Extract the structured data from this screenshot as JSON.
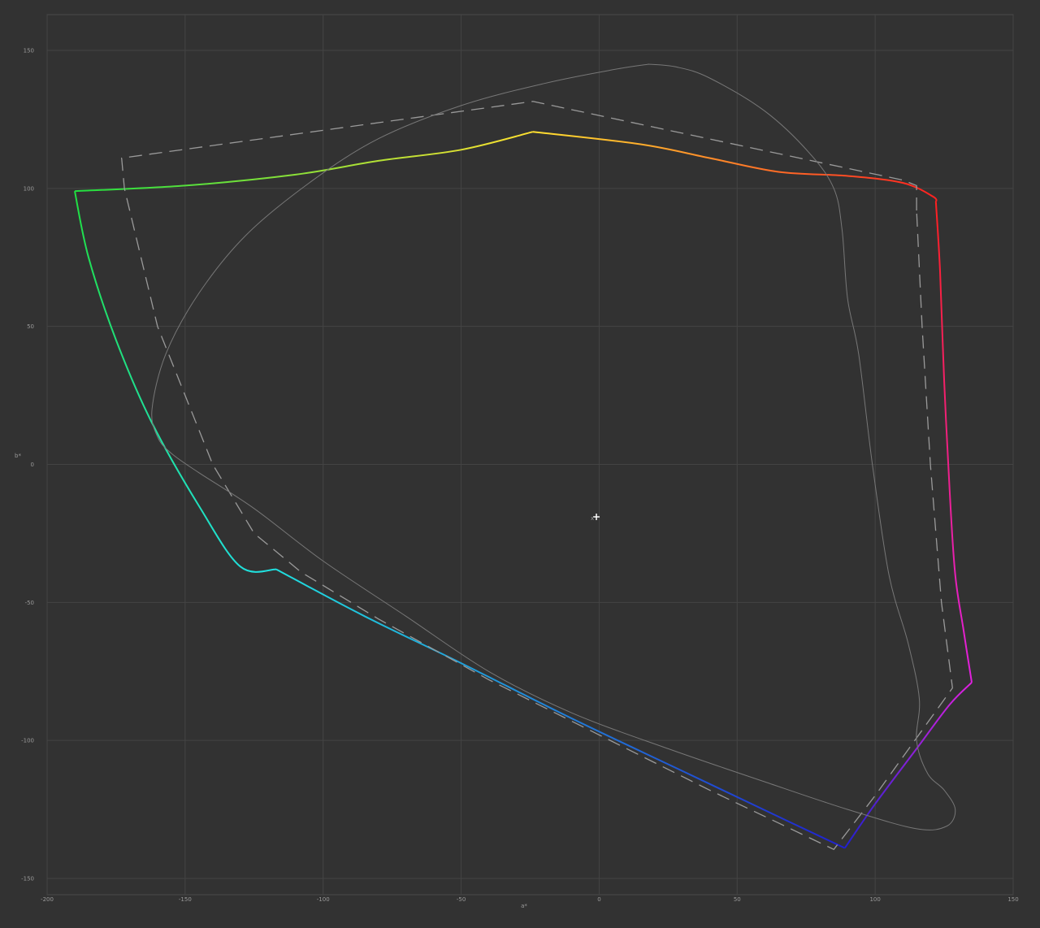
{
  "chart_data": {
    "type": "line",
    "title": "",
    "xlabel": "a*",
    "ylabel": "b*",
    "xlim": [
      -200,
      150
    ],
    "ylim": [
      -150,
      150
    ],
    "grid": true,
    "x_ticks": [
      -200,
      -150,
      -100,
      -50,
      0,
      50,
      100,
      150
    ],
    "y_ticks": [
      150,
      100,
      50,
      0,
      -50,
      -100,
      -150
    ],
    "x_tick_labels": [
      "-200",
      "-150",
      "-100",
      "-50",
      "0",
      "50",
      "100",
      "150"
    ],
    "y_tick_labels": [
      "150",
      "100",
      "50",
      "0",
      "-50",
      "-100",
      "-150"
    ],
    "white_point_marker": {
      "x": -1,
      "y": -19,
      "glyph": "+",
      "label": "x"
    },
    "series": [
      {
        "style": "solid-gradient",
        "segments": [
          {
            "from_color": "#ff2020",
            "to_color": "#ffe030",
            "points": [
              [
                122,
                95
              ],
              [
                121,
                97
              ],
              [
                110,
                102
              ],
              [
                90,
                104.5
              ],
              [
                65,
                106
              ],
              [
                40,
                111
              ],
              [
                15,
                116
              ],
              [
                -24,
                120.5
              ]
            ]
          },
          {
            "from_color": "#ffe030",
            "to_color": "#20e040",
            "points": [
              [
                -24,
                120.5
              ],
              [
                -50,
                114
              ],
              [
                -80,
                110
              ],
              [
                -110,
                105
              ],
              [
                -150,
                101
              ],
              [
                -190,
                99
              ]
            ]
          },
          {
            "from_color": "#20e040",
            "to_color": "#20e0e0",
            "points": [
              [
                -190,
                99
              ],
              [
                -185,
                75
              ],
              [
                -175,
                45
              ],
              [
                -162,
                15
              ],
              [
                -145,
                -15
              ],
              [
                -130,
                -37
              ],
              [
                -117,
                -38
              ]
            ]
          },
          {
            "from_color": "#20e0e0",
            "to_color": "#2020d0",
            "points": [
              [
                -117,
                -38
              ],
              [
                -85,
                -55
              ],
              [
                -50,
                -72
              ],
              [
                -10,
                -92
              ],
              [
                30,
                -111
              ],
              [
                70,
                -130
              ],
              [
                89,
                -139
              ]
            ]
          },
          {
            "from_color": "#2020d0",
            "to_color": "#e020e0",
            "points": [
              [
                89,
                -139
              ],
              [
                100,
                -123
              ],
              [
                115,
                -103
              ],
              [
                127,
                -87
              ],
              [
                135,
                -79
              ]
            ]
          },
          {
            "from_color": "#e020e0",
            "to_color": "#ff2020",
            "points": [
              [
                135,
                -79
              ],
              [
                132,
                -60
              ],
              [
                129,
                -40
              ],
              [
                127,
                -10
              ],
              [
                125,
                30
              ],
              [
                123.5,
                70
              ],
              [
                122,
                95
              ]
            ]
          }
        ]
      },
      {
        "style": "dashed",
        "color": "#9a9a9a",
        "points": [
          [
            115,
            92
          ],
          [
            115,
            101
          ],
          [
            110,
            103
          ],
          [
            -24,
            131.5
          ],
          [
            -173,
            111
          ],
          [
            -172,
            100
          ],
          [
            -160,
            50
          ],
          [
            -140,
            0
          ],
          [
            -125,
            -25
          ],
          [
            -108,
            -39
          ],
          [
            -80,
            -56
          ],
          [
            -40,
            -78
          ],
          [
            0,
            -98
          ],
          [
            40,
            -118
          ],
          [
            85,
            -139.5
          ],
          [
            100,
            -120
          ],
          [
            128,
            -81
          ],
          [
            124,
            -50
          ],
          [
            120,
            0
          ],
          [
            117,
            50
          ],
          [
            115,
            92
          ]
        ]
      },
      {
        "style": "thin",
        "color": "#777777",
        "points": [
          [
            18,
            145
          ],
          [
            5,
            143
          ],
          [
            -20,
            138
          ],
          [
            -50,
            130
          ],
          [
            -80,
            118
          ],
          [
            -105,
            102
          ],
          [
            -128,
            83
          ],
          [
            -145,
            62
          ],
          [
            -157,
            40
          ],
          [
            -162,
            20
          ],
          [
            -160,
            10
          ],
          [
            -155,
            4
          ],
          [
            -145,
            -3
          ],
          [
            -125,
            -16
          ],
          [
            -100,
            -35
          ],
          [
            -70,
            -55
          ],
          [
            -40,
            -75
          ],
          [
            -10,
            -90
          ],
          [
            25,
            -103
          ],
          [
            60,
            -115
          ],
          [
            90,
            -125
          ],
          [
            115,
            -132
          ],
          [
            126,
            -131
          ],
          [
            129,
            -125
          ],
          [
            125,
            -118
          ],
          [
            119,
            -112
          ],
          [
            115,
            -100
          ],
          [
            116,
            -85
          ],
          [
            112,
            -65
          ],
          [
            105,
            -40
          ],
          [
            99,
            0
          ],
          [
            94,
            40
          ],
          [
            90,
            60
          ],
          [
            88,
            85
          ],
          [
            85,
            100
          ],
          [
            76,
            113
          ],
          [
            60,
            128
          ],
          [
            40,
            140
          ],
          [
            28,
            144
          ],
          [
            18,
            145
          ]
        ]
      }
    ]
  }
}
